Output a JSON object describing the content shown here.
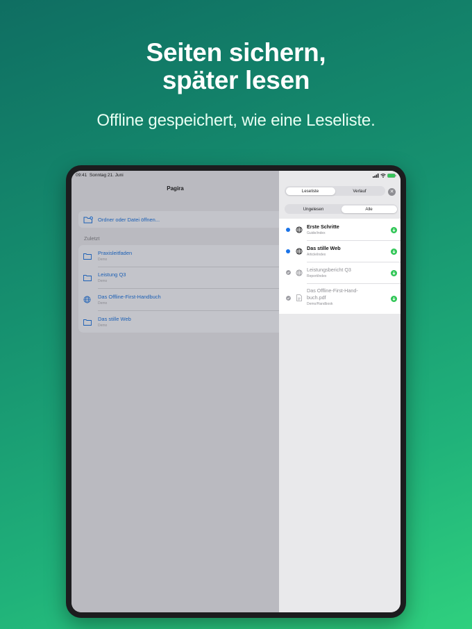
{
  "headline": {
    "line1": "Seiten sichern,",
    "line2": "später lesen"
  },
  "subline": "Offline gespeichert, wie eine Leseliste.",
  "status": {
    "time": "09:41",
    "date": "Sonntag 21. Juni",
    "battery": ""
  },
  "app": {
    "title": "Pagira"
  },
  "open_action": {
    "label": "Ordner oder Datei öffnen..."
  },
  "recent": {
    "section_label": "Zuletzt",
    "items": [
      {
        "title": "Praxisleitfaden",
        "subtitle": "Demo",
        "icon": "folder-icon"
      },
      {
        "title": "Leistung Q3",
        "subtitle": "Demo",
        "icon": "folder-icon"
      },
      {
        "title": "Das Offline-First-Handbuch",
        "subtitle": "Demo",
        "icon": "globe-icon"
      },
      {
        "title": "Das stille Web",
        "subtitle": "Demo",
        "icon": "folder-icon"
      }
    ]
  },
  "panel": {
    "tabs": [
      "Leseliste",
      "Verlauf"
    ],
    "selected_tab": "Leseliste",
    "filters": [
      "Ungelesen",
      "Alle"
    ],
    "selected_filter": "Alle",
    "close_label": "✕",
    "items": [
      {
        "title": "Erste Schritte",
        "path": "Guide/index",
        "state": "unread",
        "icon": "globe-icon"
      },
      {
        "title": "Das stille Web",
        "path": "Article/index",
        "state": "unread",
        "icon": "globe-icon"
      },
      {
        "title": "Leistungsbericht Q3",
        "path": "Report/index",
        "state": "read",
        "icon": "globe-icon"
      },
      {
        "title_line1": "Das Offline-First-Hand-",
        "title_line2": "buch.pdf",
        "path": "Demo/Handbook",
        "state": "read",
        "icon": "pdf-file-icon"
      }
    ]
  },
  "colors": {
    "accent": "#1a73e8",
    "download": "#34c759",
    "link": "#1b5fb5"
  }
}
